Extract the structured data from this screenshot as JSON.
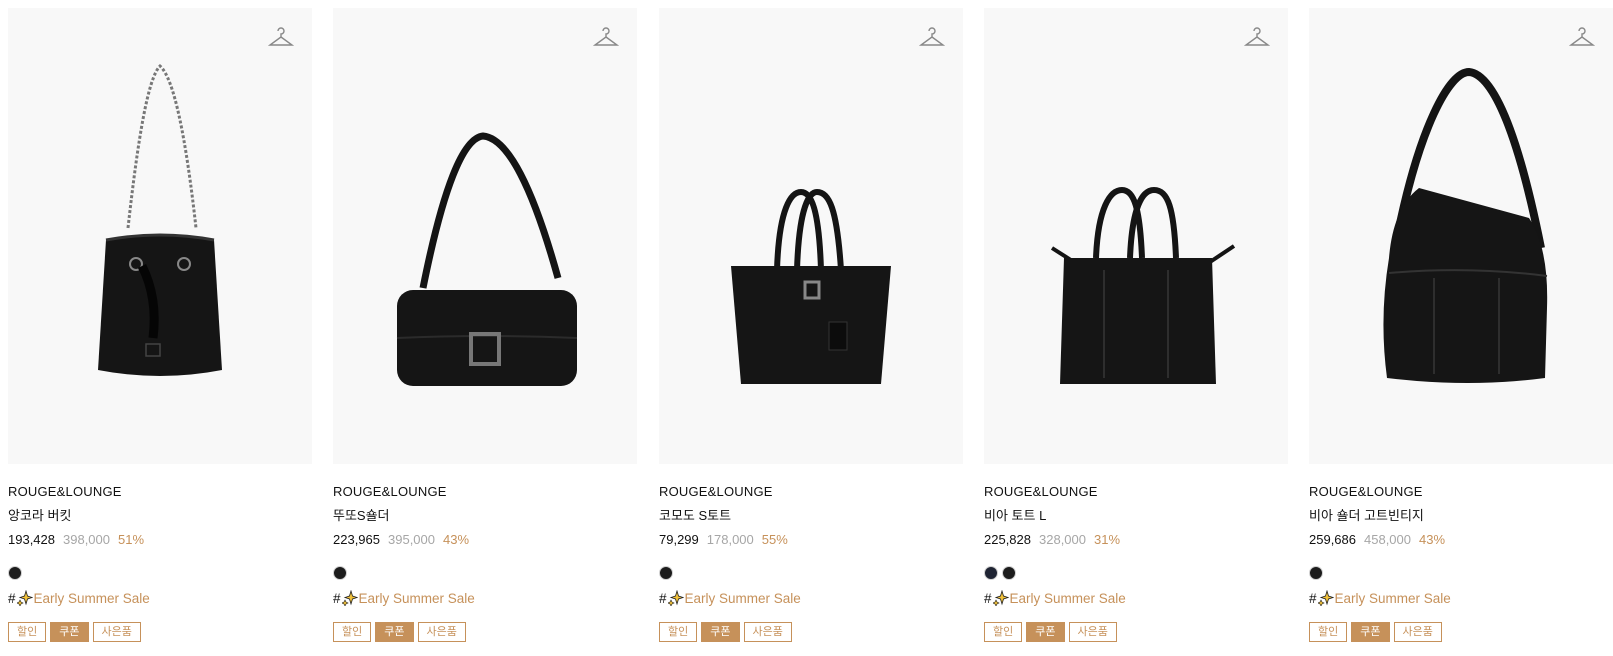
{
  "products": [
    {
      "brand": "ROUGE&LOUNGE",
      "name": "앙코라 버킷",
      "price": "193,428",
      "original_price": "398,000",
      "discount": "51%",
      "colors": [
        "#1c1c1c"
      ],
      "hashtag": "#",
      "event": "Early Summer Sale",
      "badges": [
        "할인",
        "쿠폰",
        "사은품"
      ]
    },
    {
      "brand": "ROUGE&LOUNGE",
      "name": "뚜또S숄더",
      "price": "223,965",
      "original_price": "395,000",
      "discount": "43%",
      "colors": [
        "#1c1c1c"
      ],
      "hashtag": "#",
      "event": "Early Summer Sale",
      "badges": [
        "할인",
        "쿠폰",
        "사은품"
      ]
    },
    {
      "brand": "ROUGE&LOUNGE",
      "name": "코모도 S토트",
      "price": "79,299",
      "original_price": "178,000",
      "discount": "55%",
      "colors": [
        "#1c1c1c"
      ],
      "hashtag": "#",
      "event": "Early Summer Sale",
      "badges": [
        "할인",
        "쿠폰",
        "사은품"
      ]
    },
    {
      "brand": "ROUGE&LOUNGE",
      "name": "비아 토트 L",
      "price": "225,828",
      "original_price": "328,000",
      "discount": "31%",
      "colors": [
        "#1f2433",
        "#1c1c1c"
      ],
      "hashtag": "#",
      "event": "Early Summer Sale",
      "badges": [
        "할인",
        "쿠폰",
        "사은품"
      ]
    },
    {
      "brand": "ROUGE&LOUNGE",
      "name": "비아 숄더 고트빈티지",
      "price": "259,686",
      "original_price": "458,000",
      "discount": "43%",
      "colors": [
        "#1c1c1c"
      ],
      "hashtag": "#",
      "event": "Early Summer Sale",
      "badges": [
        "할인",
        "쿠폰",
        "사은품"
      ]
    }
  ],
  "icons": {
    "hanger": "hanger-icon",
    "event": "sparkle-icon"
  },
  "accent_color": "#c6915a"
}
